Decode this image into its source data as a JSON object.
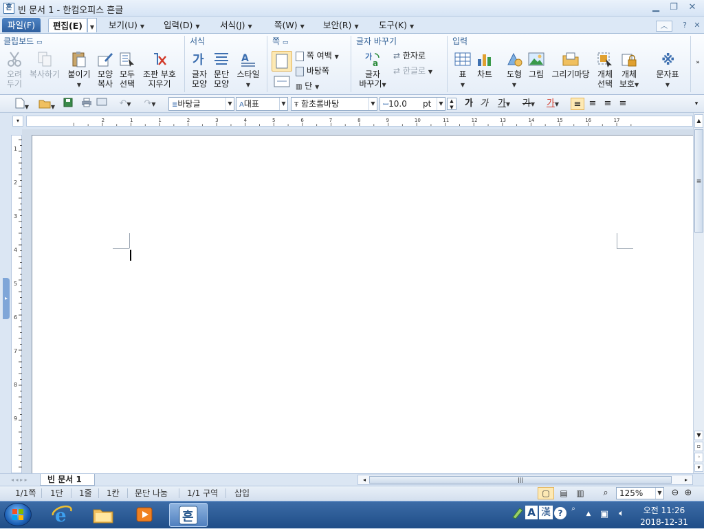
{
  "window": {
    "title": "빈 문서 1 - 한컴오피스 흔글",
    "app_icon_glyph": "흔"
  },
  "menu": {
    "file": "파일(F)",
    "items": [
      "편집(E)",
      "보기(U)",
      "입력(D)",
      "서식(J)",
      "쪽(W)",
      "보안(R)",
      "도구(K)"
    ]
  },
  "ribbon": {
    "groups": {
      "clipboard": "클립보드",
      "format": "서식",
      "page": "쪽",
      "convert": "글자 바꾸기",
      "input": "입력"
    },
    "clipboard": {
      "cut": [
        "오려",
        "두기"
      ],
      "copy": "복사하기",
      "paste": "붙이기",
      "format_copy": [
        "모양",
        "복사"
      ],
      "select_all": [
        "모두",
        "선택"
      ],
      "clear_marks": [
        "조판 부호",
        "지우기"
      ]
    },
    "format": {
      "char_shape": [
        "글자",
        "모양"
      ],
      "para_shape": [
        "문단",
        "모양"
      ],
      "style": "스타일"
    },
    "page": {
      "margin": "쪽 여백",
      "background": "바탕쪽",
      "columns": "단"
    },
    "convert": {
      "convert_chars": [
        "글자",
        "바꾸기"
      ],
      "to_hanja": "한자로",
      "to_hangul": "한글로"
    },
    "input": {
      "table": "표",
      "chart": "차트",
      "shape": "도형",
      "picture": "그림",
      "gallery": "그리기마당",
      "obj_select": [
        "개체",
        "선택"
      ],
      "obj_protect": [
        "개체",
        "보호"
      ],
      "symbols": "문자표"
    }
  },
  "toolbar": {
    "style": "바탕글",
    "lang": "대표",
    "font": "함초롬바탕",
    "size": "10.0",
    "size_unit": "pt",
    "bold": "가",
    "italic": "가",
    "underline": "가",
    "strike": "가",
    "color": "가"
  },
  "ruler_numbers": [
    "2",
    "1",
    "1",
    "2",
    "3",
    "4",
    "5",
    "6",
    "7",
    "8",
    "9",
    "10",
    "11",
    "12",
    "13",
    "14",
    "15",
    "16",
    "17"
  ],
  "vruler_numbers": [
    "1",
    "2",
    "3",
    "4",
    "5",
    "6",
    "7",
    "8",
    "9"
  ],
  "doc_tab": "빈 문서 1",
  "status": {
    "page": "1/1쪽",
    "column": "1단",
    "line": "1줄",
    "char": "1칸",
    "split": "문단 나눔",
    "section": "1/1 구역",
    "mode": "삽입",
    "zoom": "125%"
  },
  "tray": {
    "ime_lang": "A",
    "ime_hanja": "漢",
    "time": "오전 11:26",
    "date": "2018-12-31"
  },
  "colors": {
    "accent": "#2e5f9f",
    "ribbon_bg": "#e6eef8",
    "taskbar": "#1f4d87"
  }
}
